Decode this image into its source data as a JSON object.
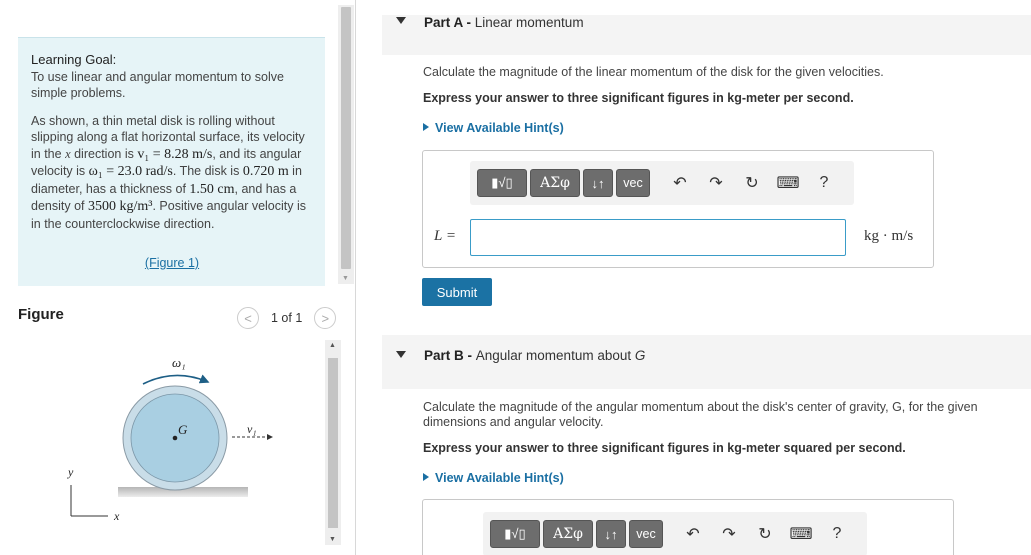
{
  "goal": {
    "title": "Learning Goal:",
    "summary": "To use linear and angular momentum to solve simple problems.",
    "desc_1": "As shown, a thin metal disk is rolling without slipping along a flat horizontal surface, its velocity in the ",
    "x_var": "x",
    "desc_2": " direction is ",
    "v_eq": "v₁ = 8.28 m/s",
    "desc_3": ", and its angular velocity is ",
    "w_eq": "ω₁ = 23.0 rad/s",
    "desc_4": ". The disk is ",
    "diam": "0.720 m",
    "desc_5": " in diameter, has a thickness of ",
    "thick": "1.50 cm",
    "desc_6": ", and has a density of ",
    "dens": "3500 kg/m³",
    "desc_7": ". Positive angular velocity is in the counterclockwise direction.",
    "figure_link": "(Figure 1)"
  },
  "figure_panel": {
    "label": "Figure",
    "count": "1 of 1",
    "prev": "<",
    "next": ">",
    "labels": {
      "omega": "ω₁",
      "center": "G",
      "velocity": "v₁",
      "y_axis": "y",
      "x_axis": "x"
    },
    "colors": {
      "disk_fill": "#a9cfe2",
      "disk_ring": "#c9dde8",
      "ground": "#bdbdbd"
    }
  },
  "partA": {
    "prefix": "Part A - ",
    "title": "Linear momentum",
    "question": "Calculate the magnitude of the linear momentum of the disk for the given velocities.",
    "instruction": "Express your answer to three significant figures in kg-meter per second.",
    "hint": "View Available Hint(s)",
    "var": "L =",
    "unit": "kg · m/s",
    "value": "",
    "submit": "Submit"
  },
  "partB": {
    "prefix": "Part B - ",
    "title": "Angular momentum about ",
    "title_var": "G",
    "question": "Calculate the magnitude of the angular momentum about the disk's center of gravity, G, for the given dimensions and angular velocity.",
    "instruction": "Express your answer to three significant figures in kg-meter squared per second.",
    "hint": "View Available Hint(s)"
  },
  "toolbar": {
    "templates": "▮√▯",
    "greek": "ΑΣφ",
    "arrows": "↓↑",
    "vec": "vec",
    "undo": "↶",
    "redo": "↷",
    "reset": "↻",
    "keyboard": "⌨",
    "help": "?"
  },
  "colors": {
    "accent": "#1b72a4",
    "goal_bg": "#e6f4f7",
    "input_border": "#3a9cc8"
  }
}
